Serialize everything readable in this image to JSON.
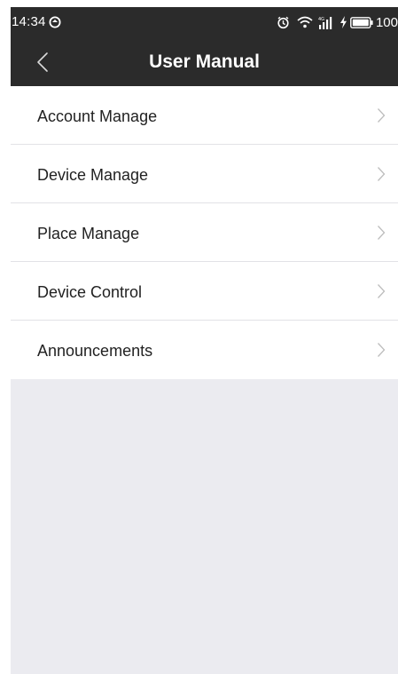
{
  "status_bar": {
    "time": "14:34",
    "battery_percent": "100",
    "icons": [
      "sync-icon",
      "alarm-icon",
      "wifi-icon",
      "signal-icon",
      "charging-icon",
      "battery-icon"
    ]
  },
  "nav": {
    "title": "User Manual",
    "back_icon": "back-chevron-icon"
  },
  "menu": {
    "items": [
      {
        "label": "Account Manage",
        "icon": "chevron-right-icon"
      },
      {
        "label": "Device Manage",
        "icon": "chevron-right-icon"
      },
      {
        "label": "Place Manage",
        "icon": "chevron-right-icon"
      },
      {
        "label": "Device Control",
        "icon": "chevron-right-icon"
      },
      {
        "label": "Announcements",
        "icon": "chevron-right-icon"
      }
    ]
  },
  "colors": {
    "header_bg": "#2b2b2b",
    "list_bg": "#ffffff",
    "page_bg": "#ebebf0",
    "divider": "#e2e2e6",
    "chevron": "#bdbdbd"
  }
}
